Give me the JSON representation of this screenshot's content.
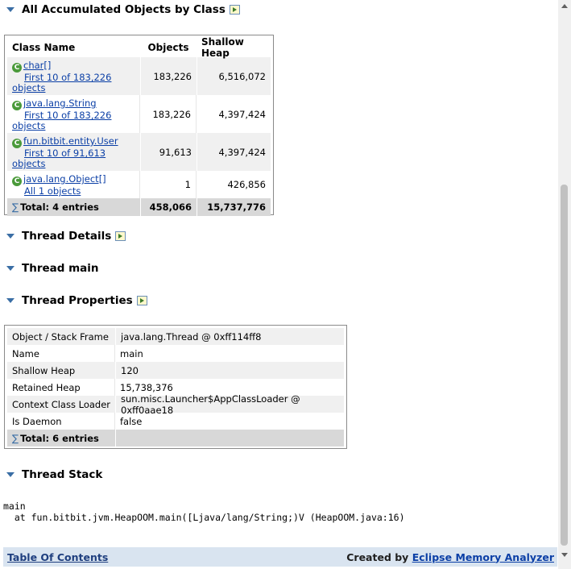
{
  "sections": {
    "accumulated": "All Accumulated Objects by Class",
    "thread_details": "Thread Details",
    "thread_main": "Thread main",
    "thread_properties": "Thread Properties",
    "thread_stack": "Thread Stack"
  },
  "class_table": {
    "headers": [
      "Class Name",
      "Objects",
      "Shallow Heap"
    ],
    "rows": [
      {
        "class": "char[]",
        "link": "First 10 of 183,226",
        "link2": "objects",
        "objects": "183,226",
        "heap": "6,516,072"
      },
      {
        "class": "java.lang.String",
        "link": "First 10 of 183,226",
        "link2": "objects",
        "objects": "183,226",
        "heap": "4,397,424"
      },
      {
        "class": "fun.bitbit.entity.User",
        "link": "First 10 of 91,613",
        "link2": "objects",
        "objects": "91,613",
        "heap": "4,397,424"
      },
      {
        "class": "java.lang.Object[]",
        "link": "All 1 objects",
        "objects": "1",
        "heap": "426,856"
      }
    ],
    "total": {
      "label": "Total: 4 entries",
      "objects": "458,066",
      "heap": "15,737,776"
    }
  },
  "props_table": {
    "rows": [
      {
        "key": "Object / Stack Frame",
        "value": "java.lang.Thread @ 0xff114ff8"
      },
      {
        "key": "Name",
        "value": "main"
      },
      {
        "key": "Shallow Heap",
        "value": "120"
      },
      {
        "key": "Retained Heap",
        "value": "15,738,376"
      },
      {
        "key": "Context Class Loader",
        "value": "sun.misc.Launcher$AppClassLoader @ 0xff0aae18"
      },
      {
        "key": "Is Daemon",
        "value": "false"
      }
    ],
    "total": "Total: 6 entries"
  },
  "stack": {
    "line1": "main",
    "line2": "  at fun.bitbit.jvm.HeapOOM.main([Ljava/lang/String;)V (HeapOOM.java:16)"
  },
  "footer": {
    "toc": "Table Of Contents",
    "created_by": "Created by",
    "tool": "Eclipse Memory Analyzer"
  },
  "colors": {
    "header_bg": "#d9e4f0",
    "row_alt": "#f0f0f0",
    "total_bg": "#d8d8d8",
    "link": "#0b3fa6"
  }
}
